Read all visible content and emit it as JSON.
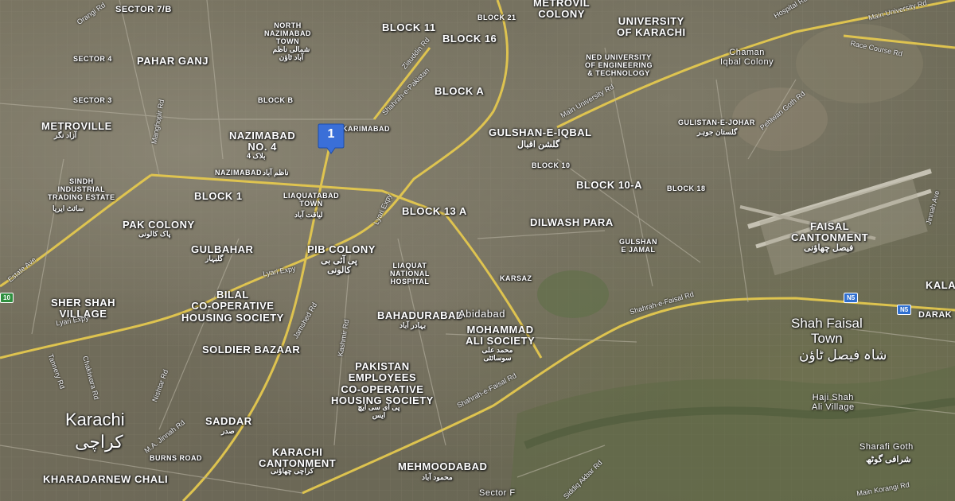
{
  "marker": {
    "number": "1"
  },
  "labels": {
    "sector_7b": "SECTOR 7/B",
    "orangi_rd": "Orangi Rd",
    "north_nazimabad": "NORTH\nNAZIMABAD\nTOWN",
    "north_nazimabad_ur": "شمالی ناظم آباد ٹاؤن",
    "block11": "BLOCK 11",
    "block16": "BLOCK 16",
    "block21": "BLOCK 21",
    "metrovil": "METROVIL\nCOLONY",
    "univ_karachi": "UNIVERSITY\nOF KARACHI",
    "chaman": "Chaman\nIqbal Colony",
    "sector4": "SECTOR 4",
    "pahar_ganj": "PAHAR GANJ",
    "ned": "NED UNIVERSITY\nOF ENGINEERING\n& TECHNOLOGY",
    "block_a": "BLOCK A",
    "block_b": "BLOCK B",
    "sector3": "SECTOR 3",
    "metroville": "METROVILLE",
    "metroville_ur": "آزاد نگر",
    "karimabad": "KARIMABAD",
    "nazimabad4": "NAZIMABAD\nNO. 4",
    "nazimabad4_ur": "بلاک 4",
    "gulshan": "GULSHAN-E-IQBAL",
    "gulshan_ur": "گلشن اقبال",
    "gulistan": "GULISTAN-E-JOHAR",
    "gulistan_ur": "گلستان جوہر",
    "block10": "BLOCK 10",
    "block10a": "BLOCK 10-A",
    "block18": "BLOCK 18",
    "nazimabad": "NAZIMABAD",
    "nazimabad_ur": "ناظم آباد",
    "sindh_ind": "SINDH\nINDUSTRIAL\nTRADING ESTATE",
    "sindh_ind_ur": "سائٹ ایریا",
    "block1": "BLOCK 1",
    "liaquatabad": "LIAQUATABAD\nTOWN",
    "liaquatabad_ur": "لیاقت آباد",
    "block13a": "BLOCK 13 A",
    "dilwash": "DILWASH PARA",
    "faisal_cant": "FAISAL\nCANTONMENT",
    "faisal_cant_ur": "فیصل چھاؤنی",
    "pak_colony": "PAK COLONY",
    "pak_colony_ur": "پاک کالونی",
    "gulbahar": "GULBAHAR",
    "gulbahar_ur": "گلبہار",
    "pib": "PIB COLONY",
    "pib_ur": "پی آئی بی کالونی",
    "liaquat_hosp": "LIAQUAT\nNATIONAL\nHOSPITAL",
    "gulshan_jamal": "GULSHAN\nE JAMAL",
    "karsaz": "KARSAZ",
    "kala": "KALA",
    "sher_shah": "SHER SHAH\nVILLAGE",
    "bilal": "BILAL\nCO-OPERATIVE\nHOUSING SOCIETY",
    "soldier": "SOLDIER BAZAAR",
    "bahadurabad": "BAHADURABAD",
    "bahadurabad_ur": "بہادر آباد",
    "abidabad": "Abidabad",
    "mohammad_ali": "MOHAMMAD\nALI SOCIETY",
    "mohammad_ali_ur": "محمد علی سوسائٹی",
    "shah_faisal": "Shah Faisal\nTown",
    "shah_faisal_ur": "شاہ فیصل ٹاؤن",
    "darak": "DARAK",
    "pechs": "PAKISTAN\nEMPLOYEES\nCO-OPERATIVE\nHOUSING SOCIETY",
    "pechs_ur": "پی ای سی ایچ ایس",
    "haji_shah": "Haji Shah\nAli Village",
    "karachi": "Karachi",
    "karachi_ur": "کراچی",
    "saddar": "SADDAR",
    "saddar_ur": "صدر",
    "karachi_cant": "KARACHI\nCANTONMENT",
    "karachi_cant_ur": "کراچی چھاؤنی",
    "burns_road": "BURNS ROAD",
    "kharadar": "KHARADAR",
    "new_chali": "NEW CHALI",
    "mehmoodabad": "MEHMOODABAD",
    "mehmoodabad_ur": "محمود آباد",
    "sharafi": "Sharafi Goth",
    "sharafi_ur": "شرافی گوٹھ",
    "sector_f": "Sector F"
  },
  "roads": {
    "shahrah_pakistan": "Shahrah-e-Pakistan",
    "ziauddin": "Ziauddin Rd",
    "main_university": "Main University Rd",
    "race_course": "Race Course Rd",
    "pehlwan_goth": "Pehlwan Goth Rd",
    "manghopir": "Manghopir Rd",
    "lyari_expy": "Lyari Expy",
    "lyari_expy2": "Lyari Expy",
    "lyari_expy3": "Lyari Expy",
    "estate_ave": "Estate Ave",
    "shahrah_faisal": "Shahrah-e-Faisal Rd",
    "shahrah_faisal2": "Shahrah-e-Faisal Rd",
    "jamshed": "Jamshed Rd",
    "kashmir": "Kashmir Rd",
    "tannery": "Tannery Rd",
    "chakiwara": "Chakiwara Rd",
    "nishtar": "Nishtar Rd",
    "jinnah": "M.A. Jinnah Rd",
    "siddiq_akbar": "Siddiq Akbar Rd",
    "main_korangi": "Main Korangi Rd",
    "jinnah_ave": "Jinnah Ave",
    "hospital_rd": "Hospital Rd"
  },
  "shields": {
    "n5a": "N5",
    "n5b": "N5",
    "m10": "10"
  }
}
